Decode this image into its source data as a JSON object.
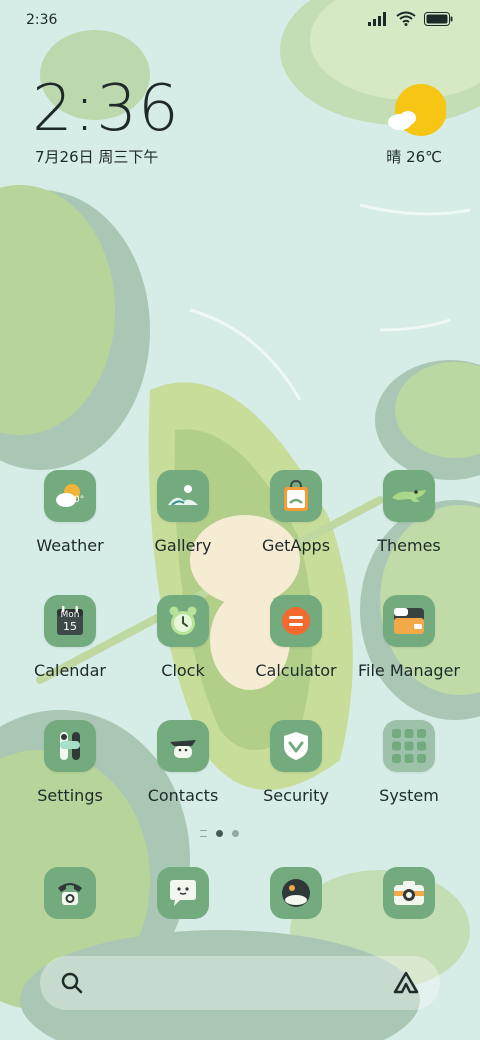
{
  "status_bar": {
    "time": "2:36",
    "signal_icon": "signal-icon",
    "wifi_icon": "wifi-icon",
    "battery_icon": "battery-icon"
  },
  "clock_widget": {
    "time": "2:36",
    "date": "7月26日 周三下午"
  },
  "weather_widget": {
    "condition_icon": "sunny-cloud-icon",
    "text": "晴 26℃"
  },
  "apps": [
    {
      "label": "Weather",
      "icon": "weather-icon"
    },
    {
      "label": "Gallery",
      "icon": "gallery-icon"
    },
    {
      "label": "GetApps",
      "icon": "getapps-icon"
    },
    {
      "label": "Themes",
      "icon": "themes-icon"
    },
    {
      "label": "Calendar",
      "icon": "calendar-icon",
      "icon_text_day": "Mon",
      "icon_text_date": "15"
    },
    {
      "label": "Clock",
      "icon": "clock-icon"
    },
    {
      "label": "Calculator",
      "icon": "calculator-icon"
    },
    {
      "label": "File Manager",
      "icon": "file-manager-icon"
    },
    {
      "label": "Settings",
      "icon": "settings-icon"
    },
    {
      "label": "Contacts",
      "icon": "contacts-icon"
    },
    {
      "label": "Security",
      "icon": "security-icon"
    },
    {
      "label": "System",
      "icon": "system-folder-icon"
    }
  ],
  "page_indicator": {
    "pages": 2,
    "active": 1
  },
  "dock": [
    {
      "icon": "phone-icon"
    },
    {
      "icon": "messages-icon"
    },
    {
      "icon": "browser-icon"
    },
    {
      "icon": "camera-icon"
    }
  ],
  "search_bar": {
    "search_icon": "search-icon",
    "assistant_icon": "assistant-icon"
  },
  "colors": {
    "tile": "#74ab7e",
    "background": "#d6ece6",
    "leaf": "#b9d8a2",
    "text": "#1f2a2a"
  }
}
